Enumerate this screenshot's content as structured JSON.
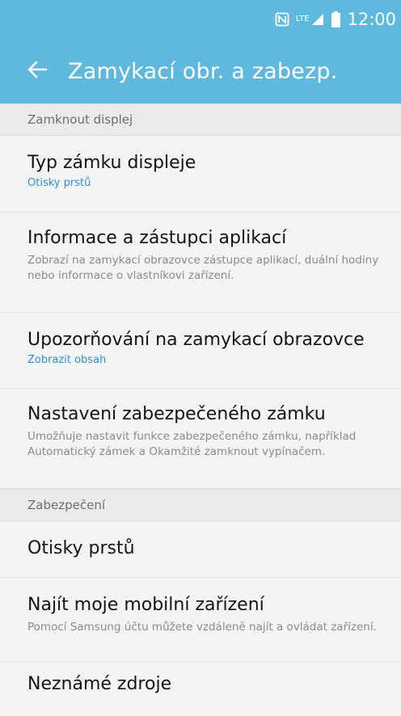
{
  "status_bar": {
    "nfc_icon": "nfc-icon",
    "lte_label": "LTE",
    "signal_icon": "signal-icon",
    "battery_icon": "battery-icon",
    "time": "12:00"
  },
  "app_bar": {
    "back_icon": "arrow-left-icon",
    "title": "Zamykací obr. a zabezp."
  },
  "sections": [
    {
      "header": "Zamknout displej",
      "items": [
        {
          "title": "Typ zámku displeje",
          "subtitle": "Otisky prstů"
        },
        {
          "title": "Informace a zástupci aplikací",
          "description": "Zobrazí na zamykací obrazovce zástupce aplikací, duální hodiny nebo informace o vlastníkovi zařízení."
        },
        {
          "title": "Upozorňování na zamykací obrazovce",
          "subtitle": "Zobrazit obsah"
        },
        {
          "title": "Nastavení zabezpečeného zámku",
          "description": "Umožňuje nastavit funkce zabezpečeného zámku, například Automatický zámek a Okamžité zamknout vypínačem."
        }
      ]
    },
    {
      "header": "Zabezpečení",
      "items": [
        {
          "title": "Otisky prstů"
        },
        {
          "title": "Najít moje mobilní zařízení",
          "description": "Pomocí Samsung účtu můžete vzdáleně najít a ovládat zařízení."
        },
        {
          "title": "Neznámé zdroje"
        }
      ]
    }
  ],
  "colors": {
    "accent": "#5fb8dd",
    "link_blue": "#2d8fd4",
    "background": "#f4f4f4",
    "section_bg": "#ebebeb"
  }
}
